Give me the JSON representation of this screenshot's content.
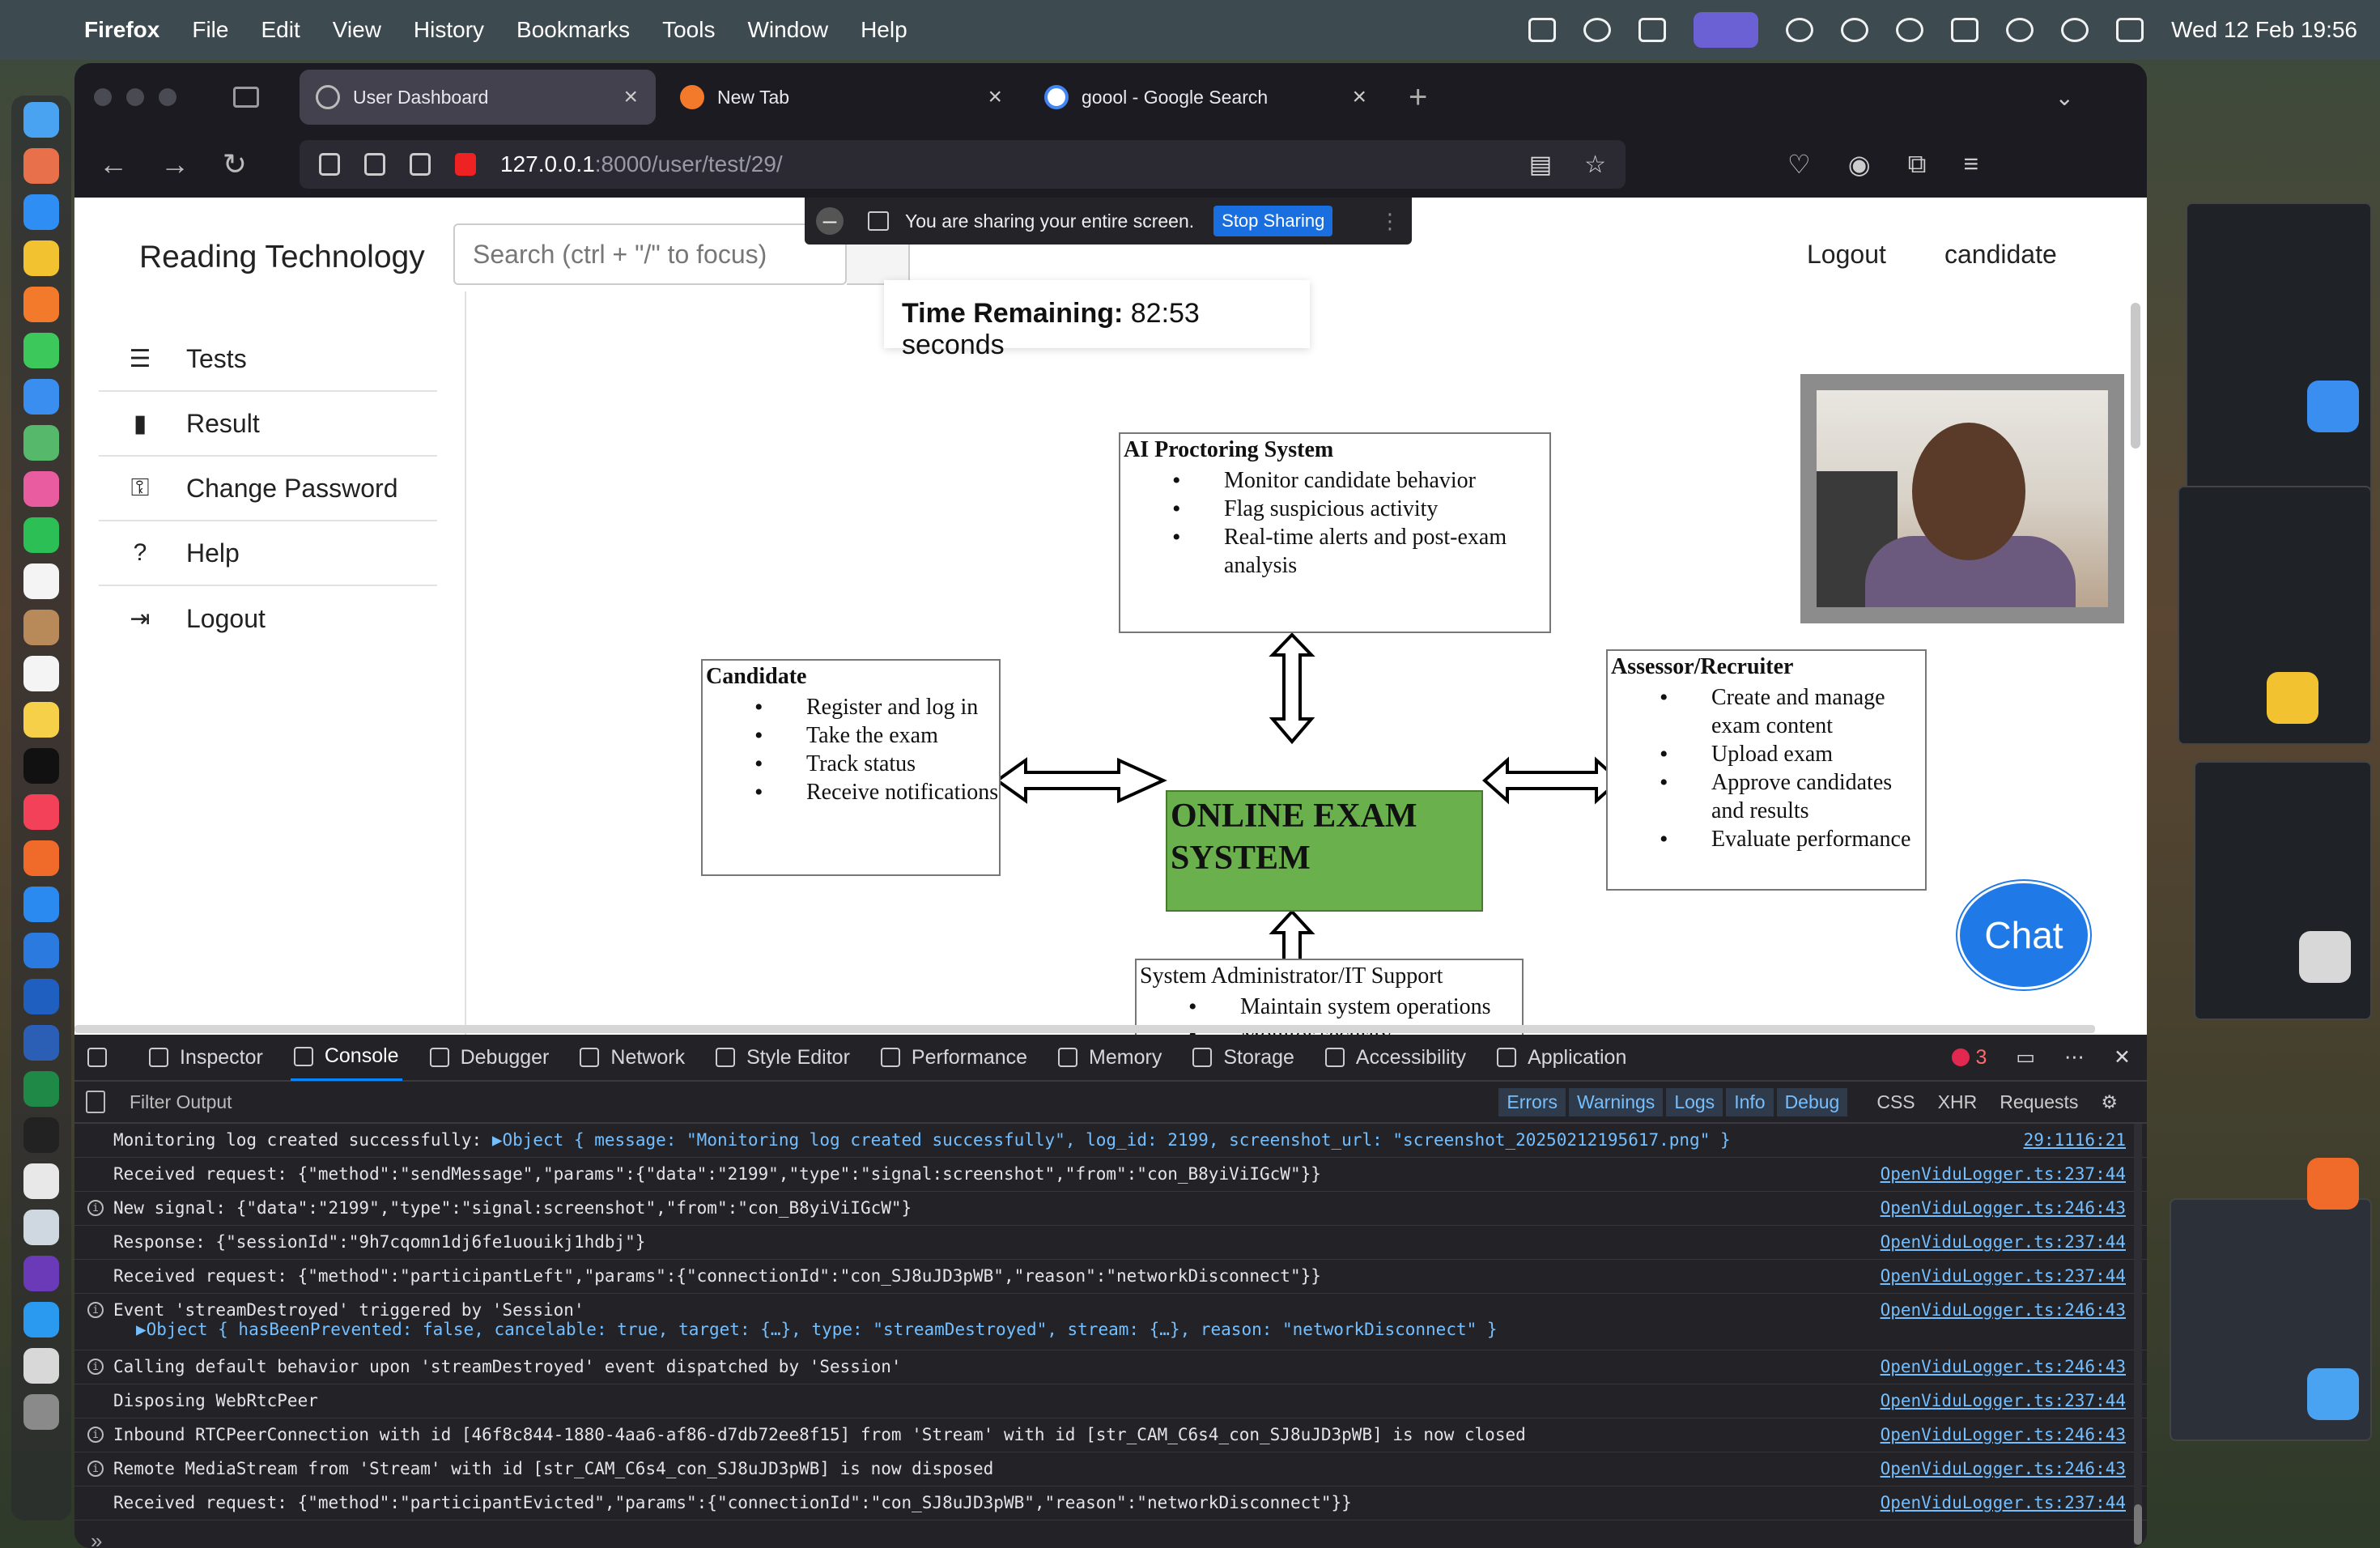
{
  "menubar": {
    "app_name": "Firefox",
    "items": [
      "File",
      "Edit",
      "View",
      "History",
      "Bookmarks",
      "Tools",
      "Window",
      "Help"
    ],
    "clock": "Wed 12 Feb  19:56"
  },
  "browser": {
    "tabs": [
      {
        "label": "User Dashboard",
        "active": true
      },
      {
        "label": "New Tab",
        "active": false
      },
      {
        "label": "goool - Google Search",
        "active": false
      }
    ],
    "url_host": "127.0.0.1",
    "url_path": ":8000/user/test/29/"
  },
  "screen_share": {
    "message": "You are sharing your entire screen.",
    "stop_label": "Stop Sharing"
  },
  "site": {
    "brand": "Reading Technology",
    "search_placeholder": "Search (ctrl + \"/\" to focus)",
    "nav": {
      "logout": "Logout",
      "user": "candidate"
    },
    "sidebar": [
      {
        "label": "Tests",
        "icon": "list-check-icon"
      },
      {
        "label": "Result",
        "icon": "clipboard-icon"
      },
      {
        "label": "Change Password",
        "icon": "key-icon"
      },
      {
        "label": "Help",
        "icon": "question-circle-icon"
      },
      {
        "label": "Logout",
        "icon": "sign-out-icon"
      }
    ],
    "timer_label": "Time Remaining:",
    "timer_value": " 82:53 seconds",
    "chat_label": "Chat"
  },
  "diagram": {
    "center": "ONLINE EXAM SYSTEM",
    "ai": {
      "title": "AI Proctoring System",
      "items": [
        "Monitor candidate behavior",
        "Flag suspicious activity",
        "Real-time alerts and post-exam analysis"
      ]
    },
    "candidate": {
      "title": "Candidate",
      "items": [
        "Register and log in",
        "Take the exam",
        "Track status",
        "Receive notifications"
      ]
    },
    "assessor": {
      "title": "Assessor/Recruiter",
      "items": [
        "Create and manage exam content",
        "Upload exam",
        "Approve candidates and results",
        "Evaluate performance"
      ]
    },
    "admin": {
      "title": "System Administrator/IT Support",
      "items": [
        "Maintain system operations",
        "Monitor security"
      ]
    }
  },
  "devtools": {
    "tabs": [
      "Inspector",
      "Console",
      "Debugger",
      "Network",
      "Style Editor",
      "Performance",
      "Memory",
      "Storage",
      "Accessibility",
      "Application"
    ],
    "active_tab": "Console",
    "error_count": "3",
    "filter_placeholder": "Filter Output",
    "levels": [
      "Errors",
      "Warnings",
      "Logs",
      "Info",
      "Debug"
    ],
    "extra_filters": [
      "CSS",
      "XHR",
      "Requests"
    ],
    "logs": [
      {
        "text": "Monitoring log created successfully:",
        "obj": "▶Object { message: \"Monitoring log created successfully\", log_id: 2199, screenshot_url: \"screenshot_20250212195617.png\" }",
        "src": "29:1116:21",
        "info": false
      },
      {
        "text": "Received request: {\"method\":\"sendMessage\",\"params\":{\"data\":\"2199\",\"type\":\"signal:screenshot\",\"from\":\"con_B8yiViIGcW\"}}",
        "src": "OpenViduLogger.ts:237:44",
        "info": false
      },
      {
        "text": "New signal: {\"data\":\"2199\",\"type\":\"signal:screenshot\",\"from\":\"con_B8yiViIGcW\"}",
        "src": "OpenViduLogger.ts:246:43",
        "info": true
      },
      {
        "text": "Response: {\"sessionId\":\"9h7cqomn1dj6fe1uouikj1hdbj\"}",
        "src": "OpenViduLogger.ts:237:44",
        "info": false
      },
      {
        "text": "Received request: {\"method\":\"participantLeft\",\"params\":{\"connectionId\":\"con_SJ8uJD3pWB\",\"reason\":\"networkDisconnect\"}}",
        "src": "OpenViduLogger.ts:237:44",
        "info": false
      },
      {
        "text": "Event 'streamDestroyed' triggered by 'Session'",
        "sub": "▶Object { hasBeenPrevented: false, cancelable: true, target: {…}, type: \"streamDestroyed\", stream: {…}, reason: \"networkDisconnect\" }",
        "src": "OpenViduLogger.ts:246:43",
        "info": true
      },
      {
        "text": "Calling default behavior upon 'streamDestroyed' event dispatched by 'Session'",
        "src": "OpenViduLogger.ts:246:43",
        "info": true
      },
      {
        "text": "Disposing WebRtcPeer",
        "src": "OpenViduLogger.ts:237:44",
        "info": false
      },
      {
        "text": "Inbound RTCPeerConnection with id [46f8c844-1880-4aa6-af86-d7db72ee8f15] from 'Stream' with id [str_CAM_C6s4_con_SJ8uJD3pWB] is now closed",
        "src": "OpenViduLogger.ts:246:43",
        "info": true
      },
      {
        "text": "Remote MediaStream from 'Stream' with id [str_CAM_C6s4_con_SJ8uJD3pWB] is now disposed",
        "src": "OpenViduLogger.ts:246:43",
        "info": true
      },
      {
        "text": "Received request: {\"method\":\"participantEvicted\",\"params\":{\"connectionId\":\"con_SJ8uJD3pWB\",\"reason\":\"networkDisconnect\"}}",
        "src": "OpenViduLogger.ts:237:44",
        "info": false
      }
    ],
    "prompt": "»"
  }
}
